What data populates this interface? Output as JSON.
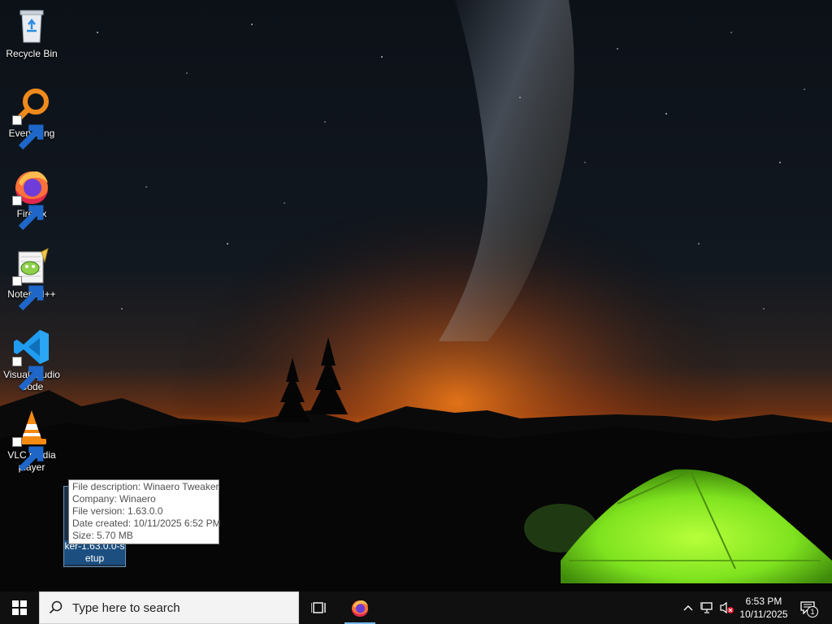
{
  "desktop": {
    "icons": [
      {
        "label": "Recycle Bin",
        "icon": "recycle-bin-icon"
      },
      {
        "label": "Everything",
        "icon": "everything-search-icon"
      },
      {
        "label": "Firefox",
        "icon": "firefox-icon"
      },
      {
        "label": "Notepad++",
        "icon": "notepad-plus-plus-icon"
      },
      {
        "label": "Visual Studio Code",
        "icon": "vscode-icon"
      },
      {
        "label": "VLC media player",
        "icon": "vlc-icon"
      }
    ],
    "selected_file": {
      "label": "ker-1.63.0.0-setup",
      "label_line1": "ker-1.63.0.0-s",
      "label_line2": "etup"
    }
  },
  "tooltip": {
    "lines": [
      "File description: Winaero Tweaker",
      "Company: Winaero",
      "File version: 1.63.0.0",
      "Date created: 10/11/2025 6:52 PM",
      "Size: 5.70 MB"
    ]
  },
  "taskbar": {
    "search_placeholder": "Type here to search",
    "pinned": [
      {
        "name": "Firefox",
        "icon": "firefox-icon",
        "active": true
      }
    ],
    "tray": {
      "time": "6:53 PM",
      "date": "10/11/2025",
      "notifications_count": "1",
      "network_status": "disconnected",
      "volume": "muted"
    }
  },
  "colors": {
    "taskbar_bg": "#101010",
    "accent": "#76b9ed",
    "tent_green": "#7fe31f"
  }
}
